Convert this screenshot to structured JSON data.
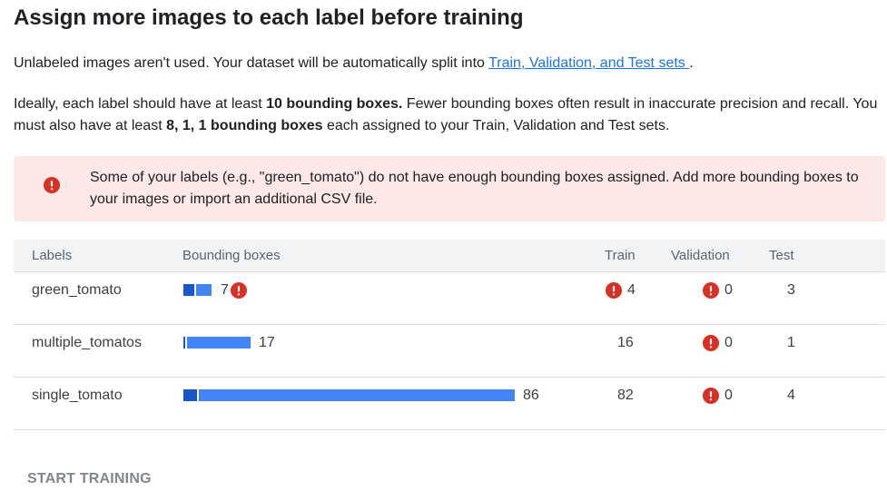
{
  "title": "Assign more images to each label before training",
  "intro": {
    "text": "Unlabeled images aren't used. Your dataset will be automatically split into ",
    "link": "Train, Validation, and Test sets ",
    "suffix": "."
  },
  "guidance": {
    "part1": "Ideally, each label should have at least ",
    "bold1": "10 bounding boxes.",
    "part2": " Fewer bounding boxes often result in inaccurate precision and recall. You must also have at least ",
    "bold2": "8, 1, 1 bounding boxes",
    "part3": " each assigned to your Train, Validation and Test sets."
  },
  "alert": {
    "icon": "error-icon",
    "message": "Some of your labels (e.g., \"green_tomato\") do not have enough bounding boxes assigned. Add more bounding boxes to your images or import an additional CSV file."
  },
  "table": {
    "headers": {
      "labels": "Labels",
      "bounding_boxes": "Bounding boxes",
      "train": "Train",
      "validation": "Validation",
      "test": "Test"
    },
    "rows": [
      {
        "label": "green_tomato",
        "boxes": "7",
        "train": "4",
        "validation": "0",
        "test": "3"
      },
      {
        "label": "multiple_tomatos",
        "boxes": "17",
        "train": "16",
        "validation": "0",
        "test": "1"
      },
      {
        "label": "single_tomato",
        "boxes": "86",
        "train": "82",
        "validation": "0",
        "test": "4"
      }
    ]
  },
  "colors": {
    "error": "#d93025",
    "alert_bg": "#fce8e6",
    "bar_dark": "#1a56c8",
    "bar_light": "#4285f4",
    "link": "#1a73e8"
  },
  "start_button": "START TRAINING"
}
